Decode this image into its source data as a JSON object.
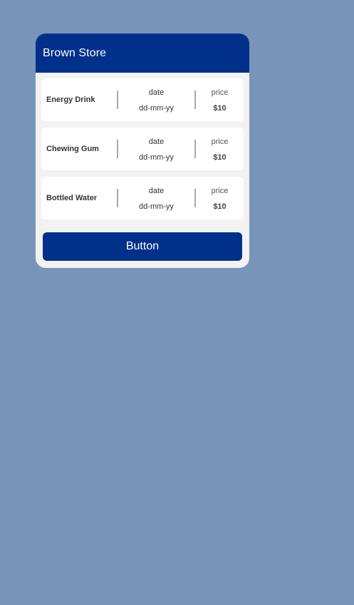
{
  "store": {
    "title": "Brown Store",
    "colors": {
      "background": "#7895b9",
      "header": "#00308a",
      "card": "#f2f2f2",
      "row": "#ffffff"
    }
  },
  "items": [
    {
      "name": "Energy Drink",
      "date_label": "date",
      "date_value": "dd-mm-yy",
      "price_label": "price",
      "price_value": "$10"
    },
    {
      "name": "Chewing Gum",
      "date_label": "date",
      "date_value": "dd-mm-yy",
      "price_label": "price",
      "price_value": "$10"
    },
    {
      "name": "Bottled Water",
      "date_label": "date",
      "date_value": "dd-mm-yy",
      "price_label": "price",
      "price_value": "$10"
    }
  ],
  "action": {
    "label": "Button"
  }
}
